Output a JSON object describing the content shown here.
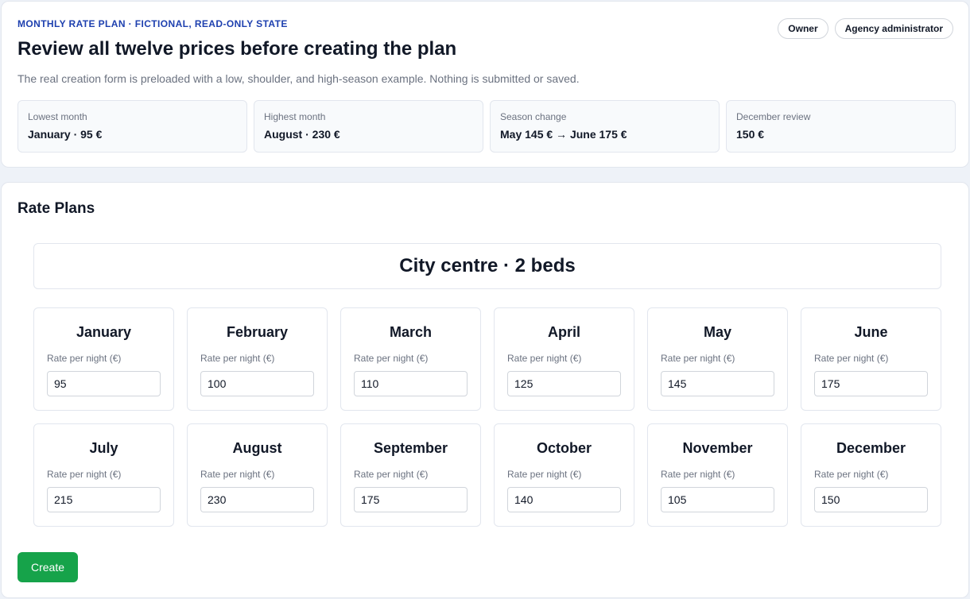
{
  "header": {
    "eyebrow": "MONTHLY RATE PLAN · FICTIONAL, READ-ONLY STATE",
    "title": "Review all twelve prices before creating the plan",
    "subtitle": "The real creation form is preloaded with a low, shoulder, and high-season example. Nothing is submitted or saved.",
    "roles": [
      "Owner",
      "Agency administrator"
    ],
    "stats": [
      {
        "label": "Lowest month",
        "value": "January · 95 €"
      },
      {
        "label": "Highest month",
        "value": "August · 230 €"
      },
      {
        "label": "Season change",
        "value": "May 145 € → June 175 €"
      },
      {
        "label": "December review",
        "value": "150 €"
      }
    ]
  },
  "main": {
    "section_title": "Rate Plans",
    "property": "City centre · 2 beds",
    "rate_label": "Rate per night (€)",
    "months": [
      {
        "name": "January",
        "rate": "95"
      },
      {
        "name": "February",
        "rate": "100"
      },
      {
        "name": "March",
        "rate": "110"
      },
      {
        "name": "April",
        "rate": "125"
      },
      {
        "name": "May",
        "rate": "145"
      },
      {
        "name": "June",
        "rate": "175"
      },
      {
        "name": "July",
        "rate": "215"
      },
      {
        "name": "August",
        "rate": "230"
      },
      {
        "name": "September",
        "rate": "175"
      },
      {
        "name": "October",
        "rate": "140"
      },
      {
        "name": "November",
        "rate": "105"
      },
      {
        "name": "December",
        "rate": "150"
      }
    ],
    "create_label": "Create"
  },
  "colors": {
    "accent_eyebrow": "#1e40af",
    "create_button": "#16a34a",
    "background": "#eef2f8"
  }
}
